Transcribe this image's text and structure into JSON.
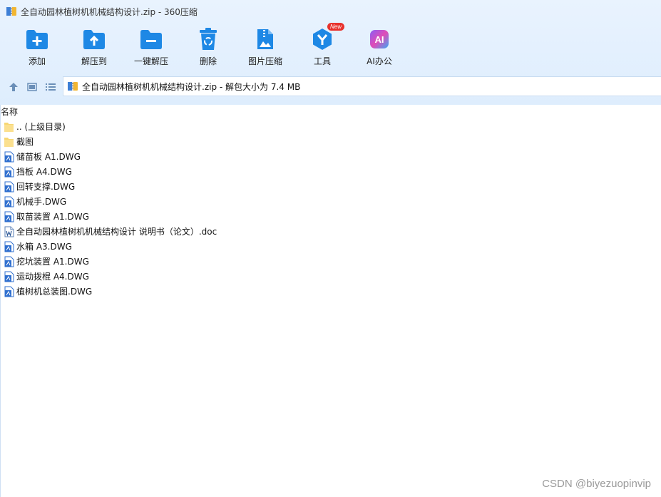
{
  "window": {
    "title": "全自动园林植树机机械结构设计.zip - 360压缩"
  },
  "toolbar": {
    "items": [
      {
        "label": "添加",
        "icon": "add-folder-icon"
      },
      {
        "label": "解压到",
        "icon": "extract-to-icon"
      },
      {
        "label": "一键解压",
        "icon": "one-click-extract-icon"
      },
      {
        "label": "删除",
        "icon": "recycle-bin-icon"
      },
      {
        "label": "图片压缩",
        "icon": "image-compress-icon"
      },
      {
        "label": "工具",
        "icon": "tools-icon",
        "badge": "New"
      },
      {
        "label": "AI办公",
        "icon": "ai-office-icon",
        "icon_text": "AI"
      }
    ]
  },
  "navbar": {
    "address": "全自动园林植树机机械结构设计.zip - 解包大小为 7.4 MB"
  },
  "list": {
    "column_name": "名称",
    "rows": [
      {
        "name": ".. (上级目录)",
        "type": "folder"
      },
      {
        "name": "截图",
        "type": "folder"
      },
      {
        "name": "储苗板 A1.DWG",
        "type": "dwg"
      },
      {
        "name": "挡板 A4.DWG",
        "type": "dwg"
      },
      {
        "name": "回转支撑.DWG",
        "type": "dwg"
      },
      {
        "name": "机械手.DWG",
        "type": "dwg"
      },
      {
        "name": "取苗装置 A1.DWG",
        "type": "dwg"
      },
      {
        "name": "全自动园林植树机机械结构设计 说明书（论文）.doc",
        "type": "doc"
      },
      {
        "name": "水箱 A3.DWG",
        "type": "dwg"
      },
      {
        "name": "挖坑装置 A1.DWG",
        "type": "dwg"
      },
      {
        "name": "运动拨棍 A4.DWG",
        "type": "dwg"
      },
      {
        "name": "植树机总装图.DWG",
        "type": "dwg"
      }
    ]
  },
  "watermark": "CSDN @biyezuopinvip",
  "colors": {
    "accent": "#1e88e5",
    "chrome_bg": "#e4f0fd",
    "folder": "#f7d774",
    "badge": "#e8322d"
  }
}
